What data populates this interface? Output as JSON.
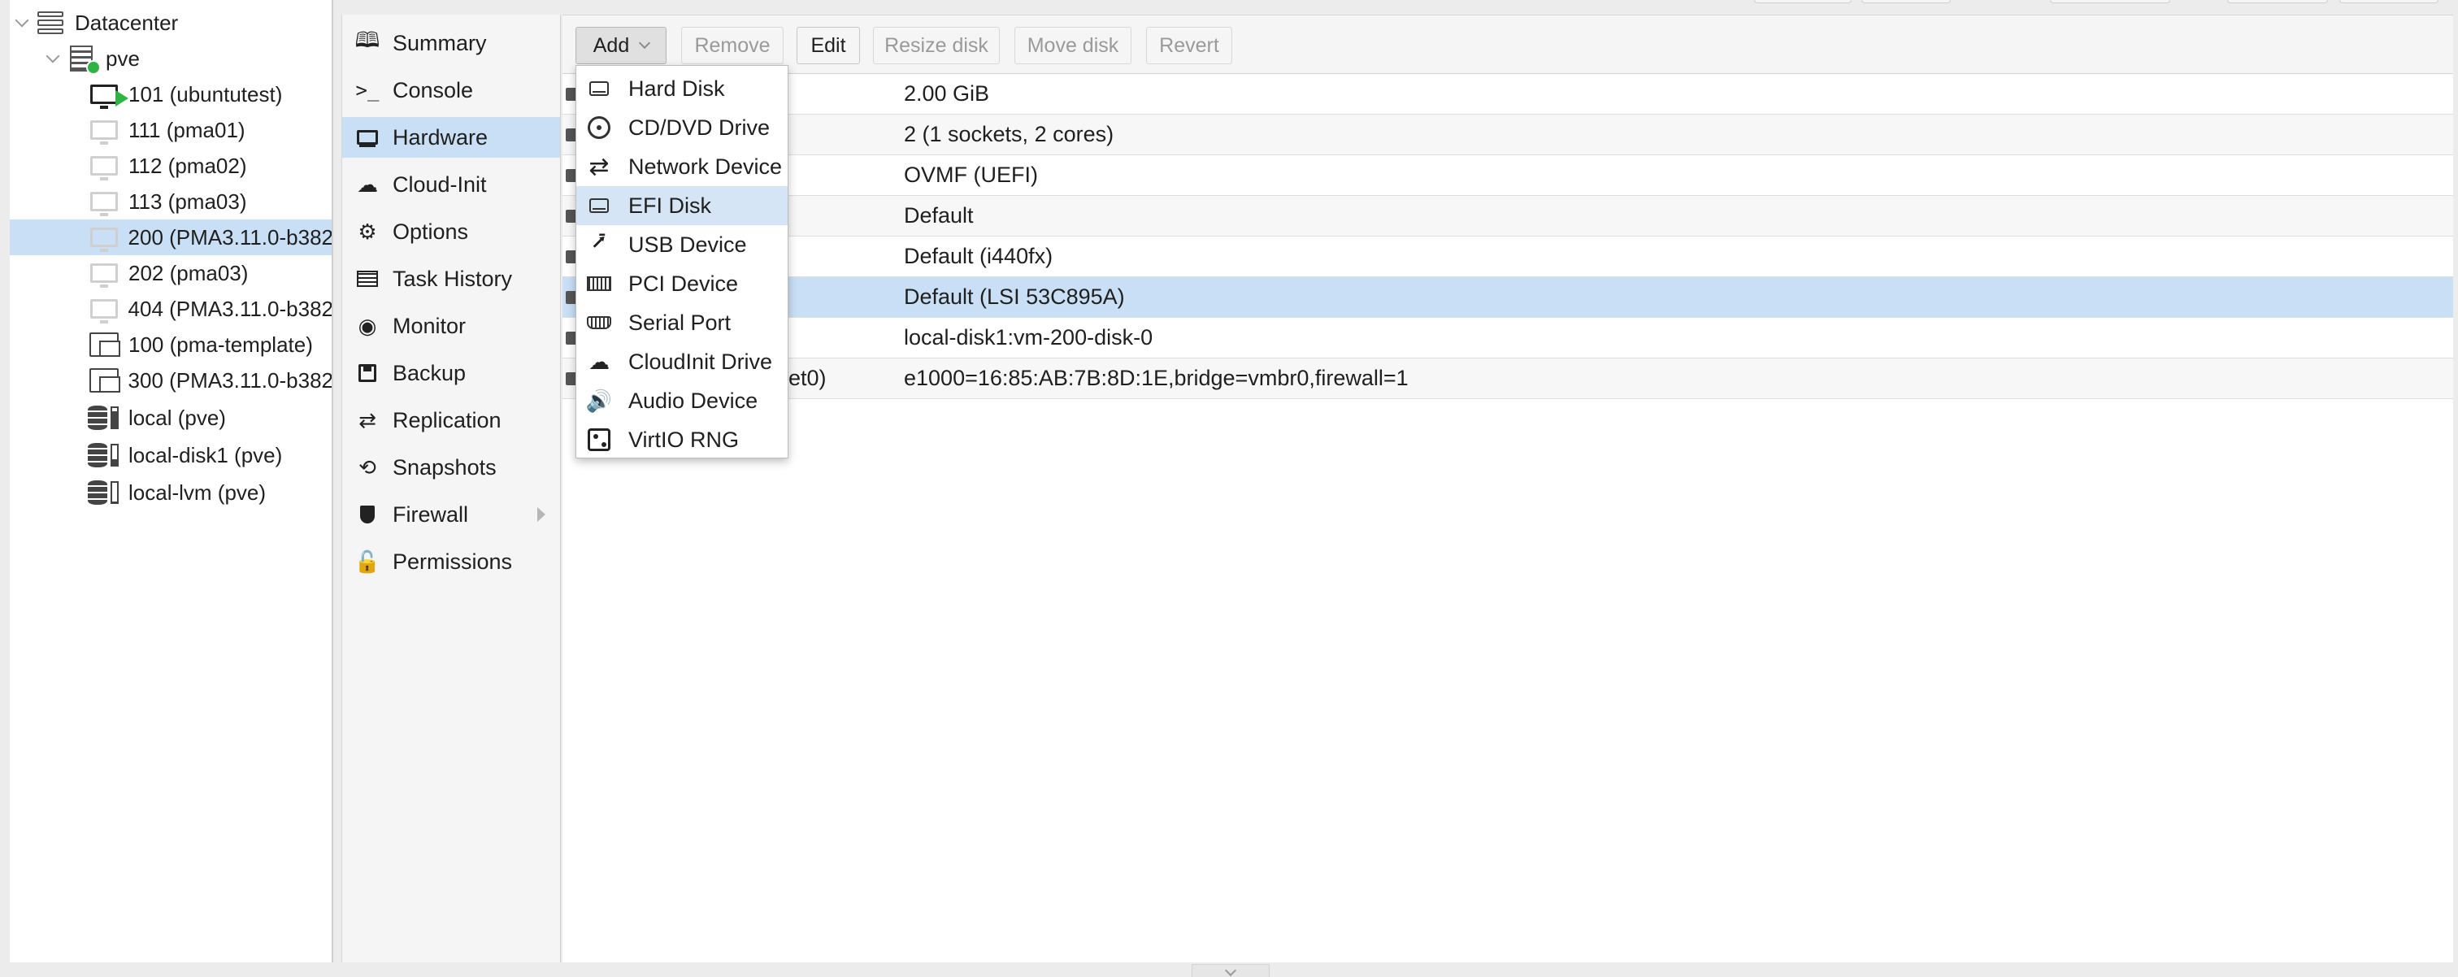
{
  "tree": {
    "items": [
      {
        "label": "Datacenter",
        "icon": "datacenter-icon"
      },
      {
        "label": "pve",
        "icon": "node-icon"
      },
      {
        "label": "101 (ubuntutest)",
        "icon": "vm-running-icon"
      },
      {
        "label": "111 (pma01)",
        "icon": "vm-stopped-icon"
      },
      {
        "label": "112 (pma02)",
        "icon": "vm-stopped-icon"
      },
      {
        "label": "113 (pma03)",
        "icon": "vm-stopped-icon"
      },
      {
        "label": "200 (PMA3.11.0-b382",
        "icon": "vm-stopped-icon"
      },
      {
        "label": "202 (pma03)",
        "icon": "vm-stopped-icon"
      },
      {
        "label": "404 (PMA3.11.0-b382",
        "icon": "vm-stopped-icon"
      },
      {
        "label": "100 (pma-template)",
        "icon": "template-icon"
      },
      {
        "label": "300 (PMA3.11.0-b382",
        "icon": "template-icon"
      },
      {
        "label": "local (pve)",
        "icon": "storage-icon",
        "usage": 0.85
      },
      {
        "label": "local-disk1 (pve)",
        "icon": "storage-icon",
        "usage": 0.3
      },
      {
        "label": "local-lvm (pve)",
        "icon": "storage-icon",
        "usage": 0.05
      }
    ]
  },
  "nav": {
    "items": [
      {
        "label": "Summary",
        "icon": "book-icon"
      },
      {
        "label": "Console",
        "icon": "terminal-icon"
      },
      {
        "label": "Hardware",
        "icon": "desktop-icon"
      },
      {
        "label": "Cloud-Init",
        "icon": "cloud-icon"
      },
      {
        "label": "Options",
        "icon": "gear-icon"
      },
      {
        "label": "Task History",
        "icon": "list-icon"
      },
      {
        "label": "Monitor",
        "icon": "eye-icon"
      },
      {
        "label": "Backup",
        "icon": "floppy-icon"
      },
      {
        "label": "Replication",
        "icon": "retweet-icon"
      },
      {
        "label": "Snapshots",
        "icon": "history-icon"
      },
      {
        "label": "Firewall",
        "icon": "shield-icon"
      },
      {
        "label": "Permissions",
        "icon": "unlock-icon"
      }
    ]
  },
  "toolbar": {
    "add": "Add",
    "remove": "Remove",
    "edit": "Edit",
    "resize_disk": "Resize disk",
    "move_disk": "Move disk",
    "revert": "Revert"
  },
  "hardware": {
    "rows": [
      {
        "key": "",
        "value": "2.00 GiB"
      },
      {
        "key": "",
        "value": "2 (1 sockets, 2 cores)"
      },
      {
        "key": "",
        "value": "OVMF (UEFI)"
      },
      {
        "key": "",
        "value": "Default"
      },
      {
        "key": "",
        "value": "Default (i440fx)"
      },
      {
        "key": "",
        "value": "Default (LSI 53C895A)"
      },
      {
        "key": "",
        "value": "local-disk1:vm-200-disk-0"
      },
      {
        "key": "et0)",
        "value": "e1000=16:85:AB:7B:8D:1E,bridge=vmbr0,firewall=1"
      }
    ]
  },
  "add_menu": {
    "items": [
      {
        "label": "Hard Disk",
        "icon": "hdd-icon"
      },
      {
        "label": "CD/DVD Drive",
        "icon": "cd-icon"
      },
      {
        "label": "Network Device",
        "icon": "exchange-icon"
      },
      {
        "label": "EFI Disk",
        "icon": "hdd-icon"
      },
      {
        "label": "USB Device",
        "icon": "usb-icon"
      },
      {
        "label": "PCI Device",
        "icon": "pci-card-icon"
      },
      {
        "label": "Serial Port",
        "icon": "serial-port-icon"
      },
      {
        "label": "CloudInit Drive",
        "icon": "cloud-icon"
      },
      {
        "label": "Audio Device",
        "icon": "speaker-icon"
      },
      {
        "label": "VirtIO RNG",
        "icon": "dice-icon"
      }
    ]
  },
  "colors": {
    "selection": "#c9dff5",
    "menu_hover": "#d5e5f5",
    "running_green": "#2fb344"
  }
}
